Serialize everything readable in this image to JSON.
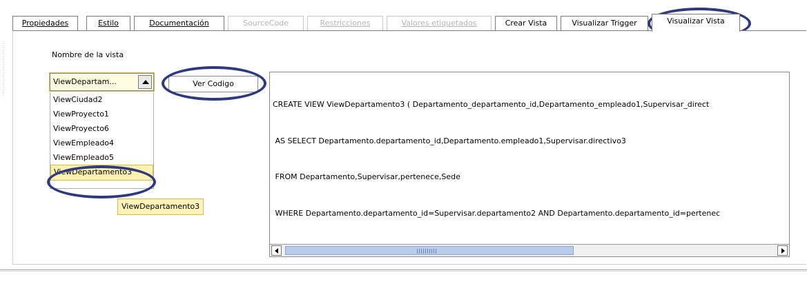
{
  "tabs": [
    {
      "label": "Propiedades",
      "state": "normal",
      "underline": true
    },
    {
      "label": "Estilo",
      "state": "normal",
      "underline": true
    },
    {
      "label": "Documentación",
      "state": "normal",
      "underline": true
    },
    {
      "label": "SourceCode",
      "state": "disabled",
      "underline": false
    },
    {
      "label": "Restricciones",
      "state": "disabled",
      "underline": true
    },
    {
      "label": "Valores etiquetados",
      "state": "disabled",
      "underline": true
    },
    {
      "label": "Crear Vista",
      "state": "normal",
      "underline": false
    },
    {
      "label": "Visualizar Trigger",
      "state": "normal",
      "underline": false
    },
    {
      "label": "Visualizar Vista",
      "state": "active",
      "underline": false
    }
  ],
  "view_form": {
    "name_label": "Nombre de la vista",
    "combo_value": "ViewDepartam...",
    "list_items": [
      "ViewCiudad2",
      "ViewProyecto1",
      "ViewProyecto6",
      "ViewEmpleado4",
      "ViewEmpleado5",
      "ViewDepartamento3"
    ],
    "selected_item": "ViewDepartamento3",
    "tooltip": "ViewDepartamento3",
    "ver_codigo_label": "Ver Codigo"
  },
  "code_area": {
    "lines": [
      "CREATE VIEW ViewDepartamento3 ( Departamento_departamento_id,Departamento_empleado1,Supervisar_direct",
      " AS SELECT Departamento.departamento_id,Departamento.empleado1,Supervisar.directivo3",
      " FROM Departamento,Supervisar,pertenece,Sede",
      " WHERE Departamento.departamento_id=Supervisar.departamento2 AND Departamento.departamento_id=pertenec"
    ]
  },
  "annotations_color": "#2f3a7e"
}
